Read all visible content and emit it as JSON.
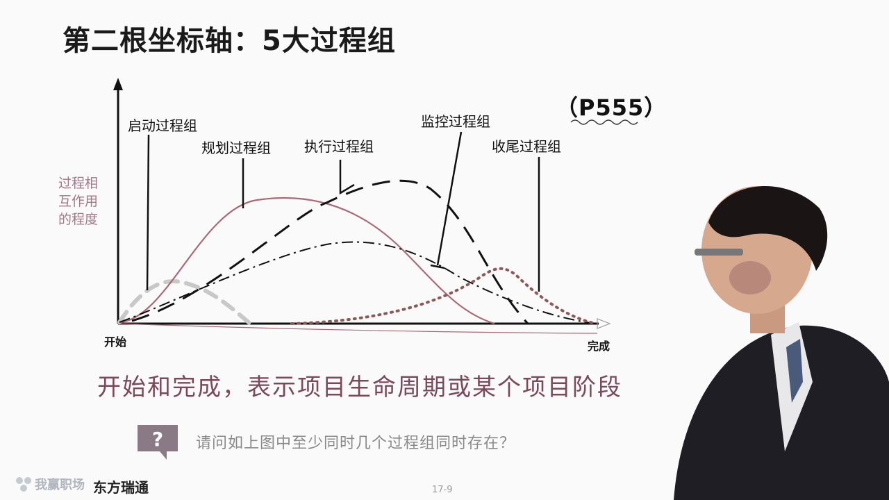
{
  "title": "第二根坐标轴：5大过程组",
  "page_ref": "（P555）",
  "y_axis_label": [
    "过程相",
    "互作用",
    "的程度"
  ],
  "x_axis_start": "开始",
  "x_axis_end": "完成",
  "process_groups": [
    {
      "name": "启动过程组",
      "style": "gray-dashed"
    },
    {
      "name": "规划过程组",
      "style": "solid"
    },
    {
      "name": "执行过程组",
      "style": "long-dash"
    },
    {
      "name": "监控过程组",
      "style": "dash-dot"
    },
    {
      "name": "收尾过程组",
      "style": "dotted"
    }
  ],
  "caption": "开始和完成，表示项目生命周期或某个项目阶段",
  "question": "请问如上图中至少同时几个过程组同时存在？",
  "logo_left": "我赢职场",
  "logo_right": "东方瑞通",
  "page_number": "17-9",
  "colors": {
    "planning_curve": "#a86a78",
    "caption": "#7a4a5a",
    "initiating_curve": "#c8c8c8"
  }
}
